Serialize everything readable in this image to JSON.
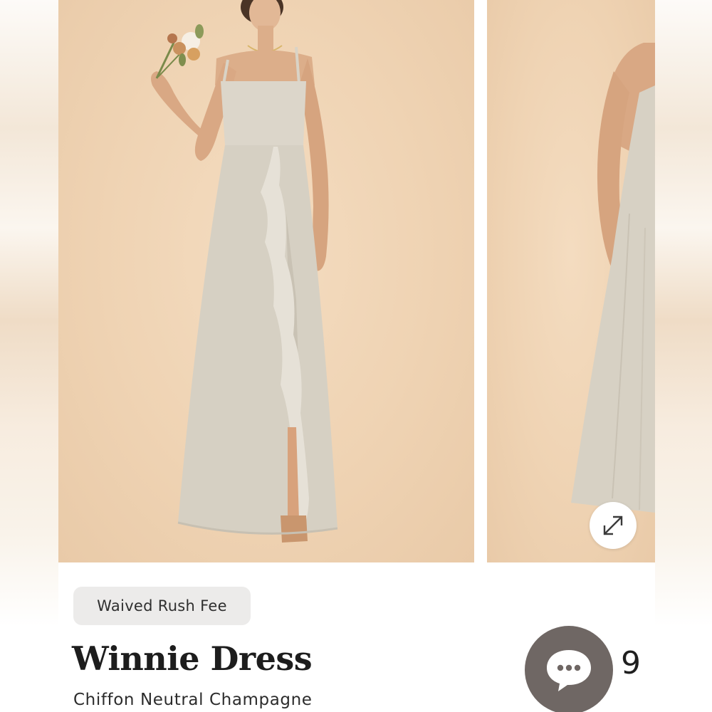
{
  "product": {
    "badge": "Waived Rush Fee",
    "title": "Winnie Dress",
    "subtitle": "Chiffon Neutral Champagne",
    "price_visible": "9"
  },
  "gallery": {
    "images": [
      {
        "name": "dress-front-photo"
      },
      {
        "name": "dress-back-photo"
      }
    ]
  },
  "icons": {
    "expand": "expand-arrows-icon",
    "chat": "chat-bubble-icon"
  },
  "colors": {
    "backdrop": "#efd3b3",
    "dress": "#d9d3c6",
    "badge_bg": "#ecebea",
    "chat_bg": "#6f6764"
  }
}
